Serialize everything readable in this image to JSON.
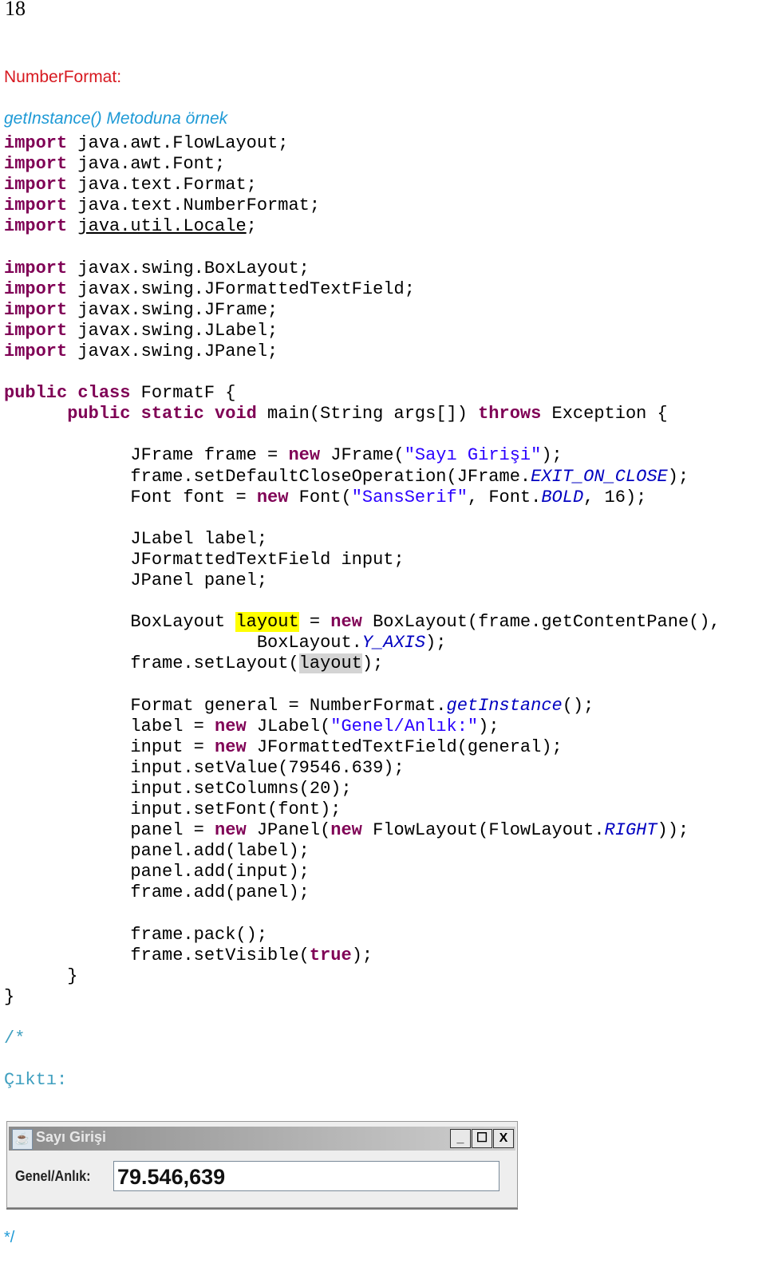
{
  "page_number": "18",
  "heading": "NumberFormat:",
  "subheading": "getInstance()  Metoduna örnek",
  "colors": {
    "keyword": "#7f0055",
    "string": "#2a00ff",
    "constant": "#0000c0",
    "heading": "#d71920",
    "subheading": "#1e9ad6",
    "highlight": "#ffff00"
  },
  "code_lines": [
    [
      [
        "import",
        "kw"
      ],
      [
        " java.awt.FlowLayout;",
        ""
      ]
    ],
    [
      [
        "import",
        "kw"
      ],
      [
        " java.awt.Font;",
        ""
      ]
    ],
    [
      [
        "import",
        "kw"
      ],
      [
        " java.text.Format;",
        ""
      ]
    ],
    [
      [
        "import",
        "kw"
      ],
      [
        " java.text.NumberFormat;",
        ""
      ]
    ],
    [
      [
        "import",
        "kw"
      ],
      [
        " ",
        ""
      ],
      [
        "java.util.Locale",
        "ul"
      ],
      [
        ";",
        ""
      ]
    ],
    [],
    [
      [
        "import",
        "kw"
      ],
      [
        " javax.swing.BoxLayout;",
        ""
      ]
    ],
    [
      [
        "import",
        "kw"
      ],
      [
        " javax.swing.JFormattedTextField;",
        ""
      ]
    ],
    [
      [
        "import",
        "kw"
      ],
      [
        " javax.swing.JFrame;",
        ""
      ]
    ],
    [
      [
        "import",
        "kw"
      ],
      [
        " javax.swing.JLabel;",
        ""
      ]
    ],
    [
      [
        "import",
        "kw"
      ],
      [
        " javax.swing.JPanel;",
        ""
      ]
    ],
    [],
    [
      [
        "public class",
        "kw"
      ],
      [
        " FormatF {",
        ""
      ]
    ],
    [
      [
        "      ",
        ""
      ],
      [
        "public static void",
        "kw"
      ],
      [
        " main(String args[]) ",
        ""
      ],
      [
        "throws",
        "kw"
      ],
      [
        " Exception {",
        ""
      ]
    ],
    [],
    [
      [
        "            JFrame frame = ",
        ""
      ],
      [
        "new",
        "kw"
      ],
      [
        " JFrame(",
        ""
      ],
      [
        "\"Sayı Girişi\"",
        "str"
      ],
      [
        ");",
        ""
      ]
    ],
    [
      [
        "            frame.setDefaultCloseOperation(JFrame.",
        ""
      ],
      [
        "EXIT_ON_CLOSE",
        "const"
      ],
      [
        ");",
        ""
      ]
    ],
    [
      [
        "            Font font = ",
        ""
      ],
      [
        "new",
        "kw"
      ],
      [
        " Font(",
        ""
      ],
      [
        "\"SansSerif\"",
        "str"
      ],
      [
        ", Font.",
        ""
      ],
      [
        "BOLD",
        "const"
      ],
      [
        ", 16);",
        ""
      ]
    ],
    [],
    [
      [
        "            JLabel label;",
        ""
      ]
    ],
    [
      [
        "            JFormattedTextField input;",
        ""
      ]
    ],
    [
      [
        "            JPanel panel;",
        ""
      ]
    ],
    [],
    [
      [
        "            BoxLayout ",
        ""
      ],
      [
        "layout",
        "hl"
      ],
      [
        " = ",
        ""
      ],
      [
        "new",
        "kw"
      ],
      [
        " BoxLayout(frame.getContentPane(),",
        ""
      ]
    ],
    [
      [
        "                        BoxLayout.",
        ""
      ],
      [
        "Y_AXIS",
        "const"
      ],
      [
        ");",
        ""
      ]
    ],
    [
      [
        "            frame.setLayout(",
        ""
      ],
      [
        "layout",
        "sel"
      ],
      [
        ");",
        ""
      ]
    ],
    [],
    [
      [
        "            Format general = NumberFormat.",
        ""
      ],
      [
        "getInstance",
        "const"
      ],
      [
        "();",
        ""
      ]
    ],
    [
      [
        "            label = ",
        ""
      ],
      [
        "new",
        "kw"
      ],
      [
        " JLabel(",
        ""
      ],
      [
        "\"Genel/Anlık:\"",
        "str"
      ],
      [
        ");",
        ""
      ]
    ],
    [
      [
        "            input = ",
        ""
      ],
      [
        "new",
        "kw"
      ],
      [
        " JFormattedTextField(general);",
        ""
      ]
    ],
    [
      [
        "            input.setValue(79546.639);",
        ""
      ]
    ],
    [
      [
        "            input.setColumns(20);",
        ""
      ]
    ],
    [
      [
        "            input.setFont(font);",
        ""
      ]
    ],
    [
      [
        "            panel = ",
        ""
      ],
      [
        "new",
        "kw"
      ],
      [
        " JPanel(",
        ""
      ],
      [
        "new",
        "kw"
      ],
      [
        " FlowLayout(FlowLayout.",
        ""
      ],
      [
        "RIGHT",
        "const"
      ],
      [
        "));",
        ""
      ]
    ],
    [
      [
        "            panel.add(label);",
        ""
      ]
    ],
    [
      [
        "            panel.add(input);",
        ""
      ]
    ],
    [
      [
        "            frame.add(panel);",
        ""
      ]
    ],
    [],
    [
      [
        "            frame.pack();",
        ""
      ]
    ],
    [
      [
        "            frame.setVisible(",
        ""
      ],
      [
        "true",
        "kw"
      ],
      [
        ");",
        ""
      ]
    ],
    [
      [
        "      }",
        ""
      ]
    ],
    [
      [
        "}",
        ""
      ]
    ],
    [],
    [
      [
        "/*",
        "com"
      ]
    ],
    [],
    [
      [
        "Çıktı:",
        "com"
      ]
    ]
  ],
  "output_window": {
    "title": "Sayı Girişi",
    "icon": "java-cup-icon",
    "buttons": {
      "minimize": "_",
      "maximize": "☐",
      "close": "X"
    },
    "label": "Genel/Anlık:",
    "value": "79.546,639"
  },
  "comment_end": "*/"
}
